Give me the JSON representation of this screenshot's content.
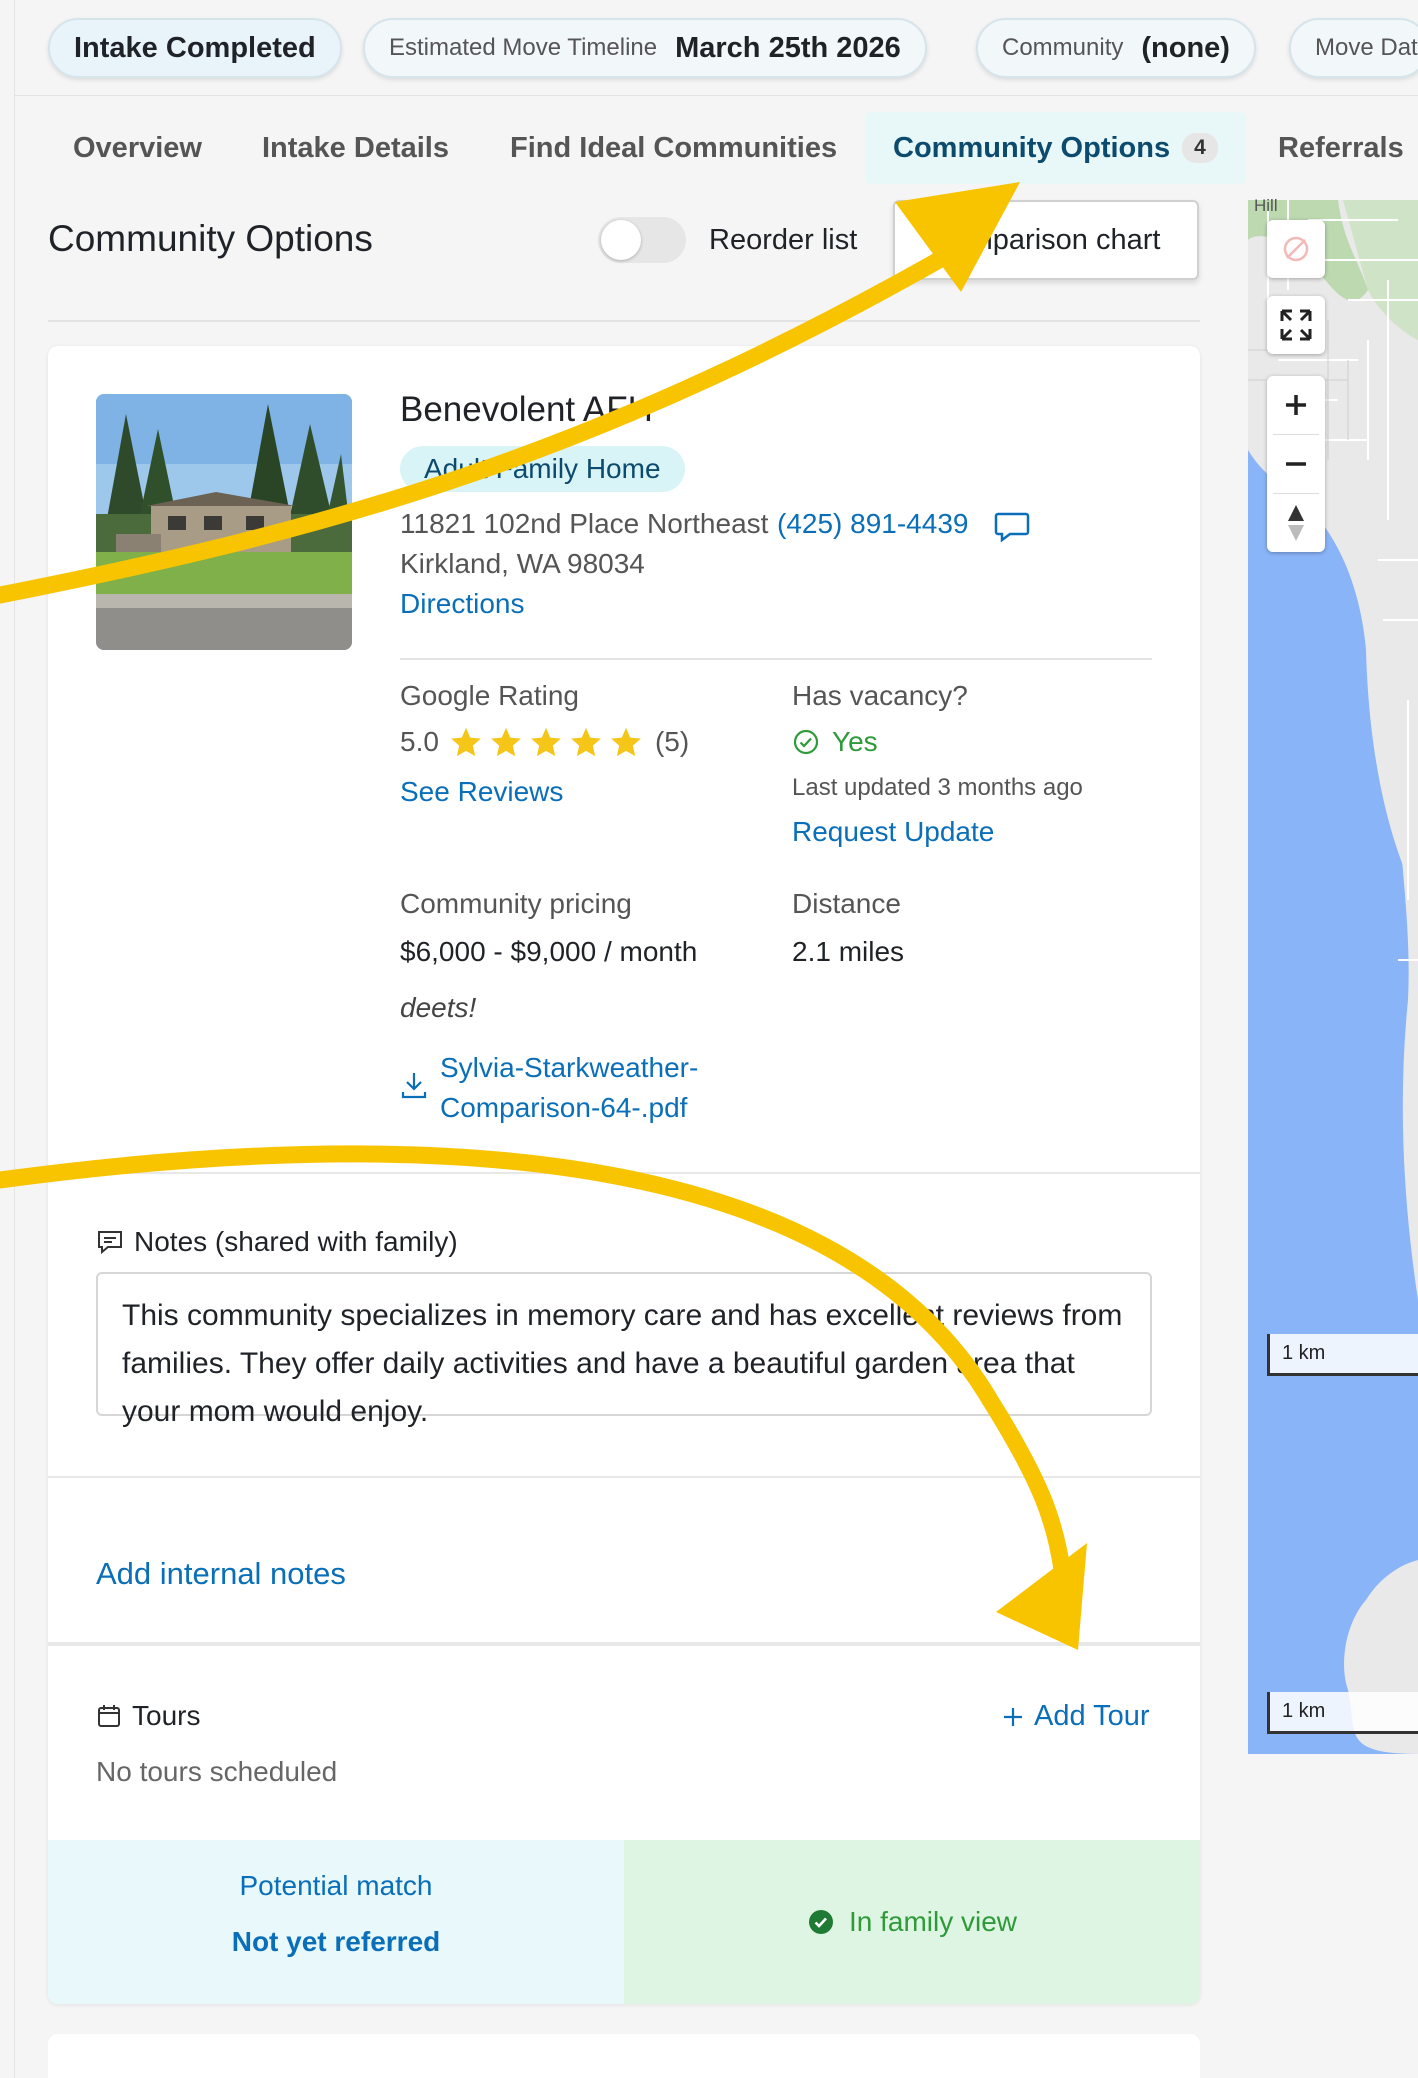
{
  "status_pills": {
    "intake": "Intake Completed",
    "timeline_label": "Estimated Move Timeline",
    "timeline_value": "March 25th 2026",
    "community_label": "Community",
    "community_value": "(none)",
    "move_date_label": "Move Dat"
  },
  "tabs": [
    {
      "label": "Overview"
    },
    {
      "label": "Intake Details"
    },
    {
      "label": "Find Ideal Communities"
    },
    {
      "label": "Community Options",
      "count": "4",
      "active": true
    },
    {
      "label": "Referrals"
    }
  ],
  "section": {
    "title": "Community Options",
    "reorder_label": "Reorder list",
    "reorder_enabled": false,
    "comparison_button": "Comparison chart"
  },
  "community": {
    "name": "Benevolent AFH",
    "type": "Adult Family Home",
    "address_line1": "11821 102nd Place Northeast",
    "address_line2": "Kirkland, WA 98034",
    "phone": "(425) 891-4439",
    "directions_label": "Directions",
    "rating": {
      "label": "Google Rating",
      "value": "5.0",
      "stars": 5,
      "count": "(5)",
      "reviews_link": "See Reviews"
    },
    "vacancy": {
      "label": "Has vacancy?",
      "value": "Yes",
      "updated": "Last updated 3 months ago",
      "request_link": "Request Update"
    },
    "pricing": {
      "label": "Community pricing",
      "value": "$6,000 - $9,000 / month"
    },
    "distance": {
      "label": "Distance",
      "value": "2.1 miles"
    },
    "note_italic": "deets!",
    "attachment": "Sylvia-Starkweather-Comparison-64-.pdf",
    "notes_label": "Notes (shared with family)",
    "notes_text": "This community specializes in memory care and has excellent reviews from families. They offer daily activities and have a beautiful garden area that your mom would enjoy.",
    "internal_notes_link": "Add internal notes",
    "tours": {
      "label": "Tours",
      "add_label": "Add Tour",
      "empty": "No tours scheduled"
    },
    "status": {
      "match": "Potential match",
      "referral": "Not yet referred",
      "family_view": "In family view"
    }
  },
  "map": {
    "place_label": "Hill",
    "scale_label": "1 km",
    "icons": [
      "eye-off-icon",
      "fullscreen-icon",
      "zoom-in-icon",
      "zoom-out-icon",
      "compass-icon"
    ]
  },
  "colors": {
    "link": "#0a6fb8",
    "active_tab_bg": "#e8f7f8",
    "success": "#2e9a3a",
    "star": "#f5c518",
    "annotation_arrow": "#f8c400"
  }
}
